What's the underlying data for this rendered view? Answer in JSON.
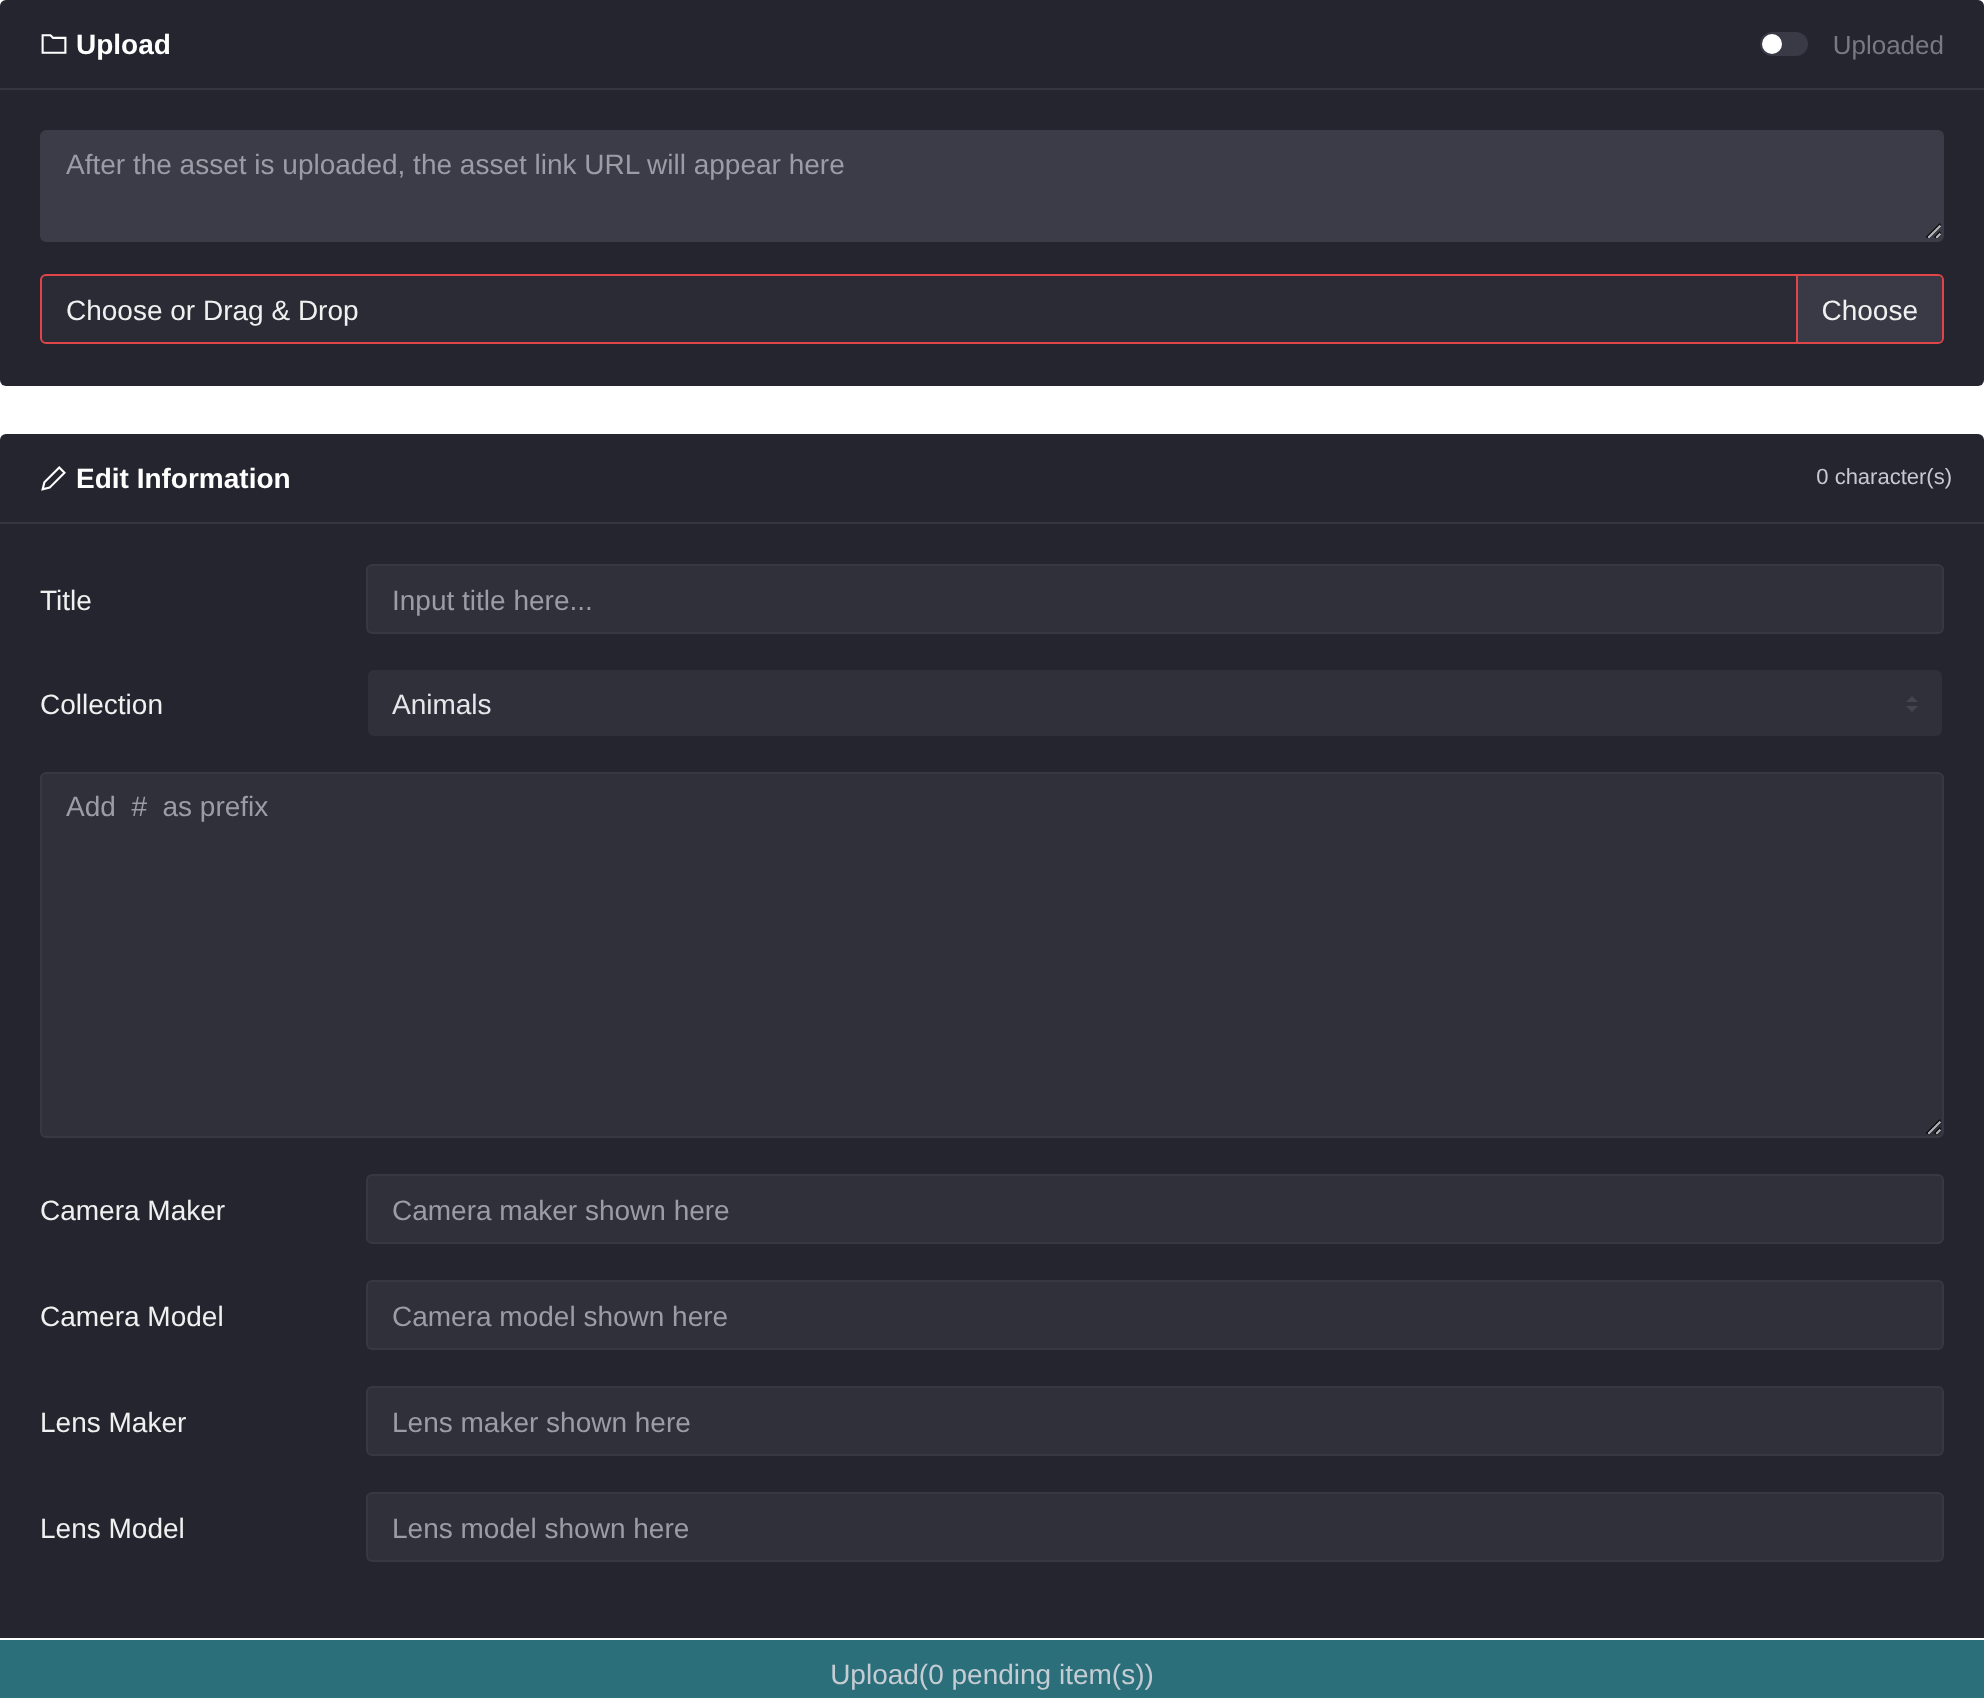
{
  "upload_card": {
    "title": "Upload",
    "toggle": {
      "label": "Uploaded",
      "on": false
    },
    "url_box": {
      "placeholder": "After the asset is uploaded, the asset link URL will appear here"
    },
    "file_picker": {
      "placeholder": "Choose or Drag & Drop",
      "button": "Choose",
      "invalid": true
    }
  },
  "edit_card": {
    "title": "Edit Information",
    "counter": "0 character(s)",
    "fields": [
      {
        "kind": "input",
        "label": "Title",
        "placeholder": "Input title here..."
      },
      {
        "kind": "select",
        "label": "Collection",
        "value": "Animals"
      },
      {
        "kind": "textarea",
        "placeholder": "Add  #  as prefix"
      },
      {
        "kind": "input",
        "label": "Camera Maker",
        "placeholder": "Camera maker shown here"
      },
      {
        "kind": "input",
        "label": "Camera Model",
        "placeholder": "Camera model shown here"
      },
      {
        "kind": "input",
        "label": "Lens Maker",
        "placeholder": "Lens maker shown here"
      },
      {
        "kind": "input",
        "label": "Lens Model",
        "placeholder": "Lens model shown here"
      }
    ]
  },
  "submit_button": "Upload(0 pending item(s))"
}
